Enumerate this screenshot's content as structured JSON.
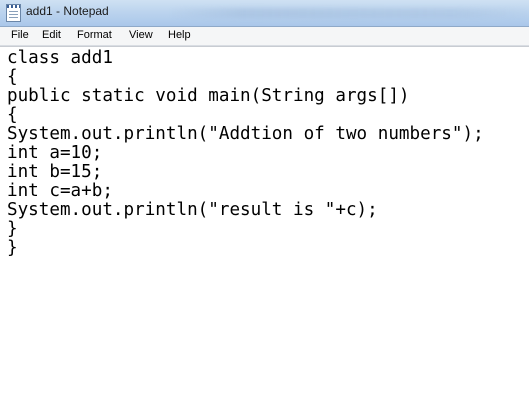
{
  "window": {
    "title": "add1 - Notepad"
  },
  "menubar": {
    "items": [
      "File",
      "Edit",
      "Format",
      "View",
      "Help"
    ]
  },
  "editor": {
    "lines": [
      "class add1",
      "{",
      "public static void main(String args[])",
      "{",
      "System.out.println(\"Addtion of two numbers\");",
      "int a=10;",
      "int b=15;",
      "int c=a+b;",
      "System.out.println(\"result is \"+c);",
      "}",
      "}"
    ]
  },
  "icons": {
    "app": "notepad-icon"
  },
  "colors": {
    "titlebar": "#bcd4ee",
    "menubar": "#f5f6f7",
    "editor_bg": "#ffffff",
    "text": "#000000"
  }
}
